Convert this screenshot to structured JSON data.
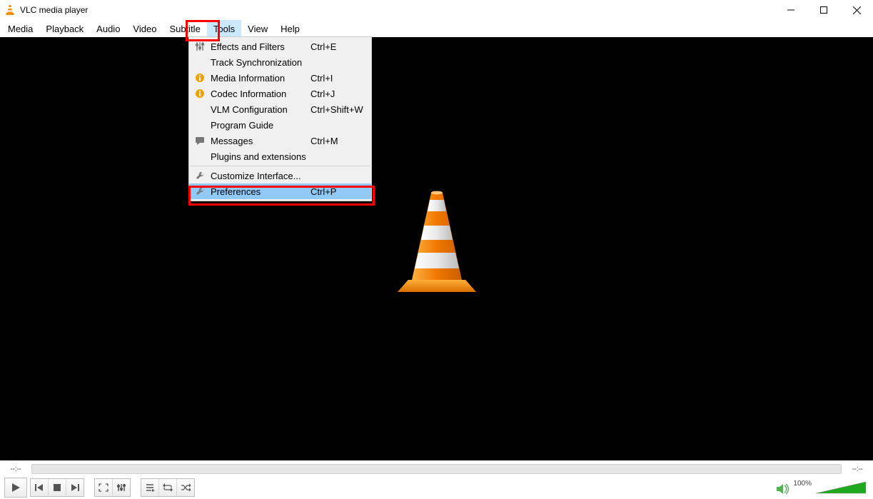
{
  "title": "VLC media player",
  "menubar": [
    "Media",
    "Playback",
    "Audio",
    "Video",
    "Subtitle",
    "Tools",
    "View",
    "Help"
  ],
  "open_menu_index": 5,
  "dropdown": [
    {
      "icon": "sliders",
      "label": "Effects and Filters",
      "shortcut": "Ctrl+E"
    },
    {
      "icon": "",
      "label": "Track Synchronization",
      "shortcut": ""
    },
    {
      "icon": "info",
      "label": "Media Information",
      "shortcut": "Ctrl+I"
    },
    {
      "icon": "info",
      "label": "Codec Information",
      "shortcut": "Ctrl+J"
    },
    {
      "icon": "",
      "label": "VLM Configuration",
      "shortcut": "Ctrl+Shift+W"
    },
    {
      "icon": "",
      "label": "Program Guide",
      "shortcut": ""
    },
    {
      "icon": "msg",
      "label": "Messages",
      "shortcut": "Ctrl+M"
    },
    {
      "icon": "",
      "label": "Plugins and extensions",
      "shortcut": ""
    },
    {
      "sep": true
    },
    {
      "icon": "wrench",
      "label": "Customize Interface...",
      "shortcut": ""
    },
    {
      "icon": "wrench",
      "label": "Preferences",
      "shortcut": "Ctrl+P",
      "highlighted": true
    }
  ],
  "time_left": "--:--",
  "time_right": "--:--",
  "volume_label": "100%"
}
